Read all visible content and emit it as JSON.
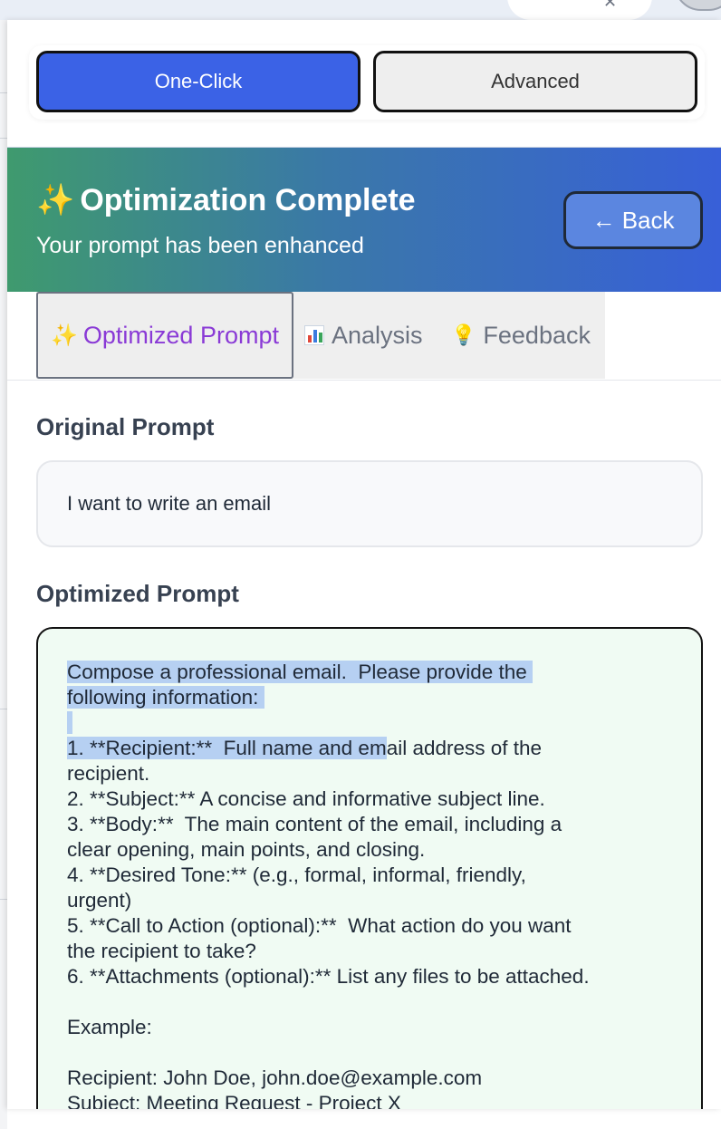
{
  "mode_tabs": {
    "one_click": "One-Click",
    "advanced": "Advanced"
  },
  "header": {
    "sparkle": "✨",
    "title": "Optimization Complete",
    "subtitle": "Your prompt has been enhanced",
    "back_label": "← Back"
  },
  "result_tabs": [
    {
      "icon": "sparkles-icon",
      "label": "Optimized Prompt"
    },
    {
      "icon": "bar-chart-icon",
      "label": "Analysis"
    },
    {
      "icon": "lightbulb-icon",
      "label": "Feedback"
    }
  ],
  "original": {
    "heading": "Original Prompt",
    "text": "I want to write an email"
  },
  "optimized": {
    "heading": "Optimized Prompt",
    "line_1": "Compose a professional email.  Please provide the ",
    "line_2": "following information: ",
    "line_3": " ",
    "line_4a": "1. **Recipient:**  Full name and em",
    "line_4b": "ail address of the",
    "rest": "recipient.\n2. **Subject:** A concise and informative subject line.\n3. **Body:**  The main content of the email, including a\nclear opening, main points, and closing.\n4. **Desired Tone:** (e.g., formal, informal, friendly,\nurgent)\n5. **Call to Action (optional):**  What action do you want\nthe recipient to take?\n6. **Attachments (optional):** List any files to be attached.\n\nExample:\n\nRecipient: John Doe, john.doe@example.com\nSubject: Meeting Request - Project X"
  },
  "colors": {
    "primary": "#3b62e6",
    "active_tab_text": "#8a3ad6",
    "optimized_bg": "#f0fbf3",
    "selection": "#b6d0f2"
  }
}
